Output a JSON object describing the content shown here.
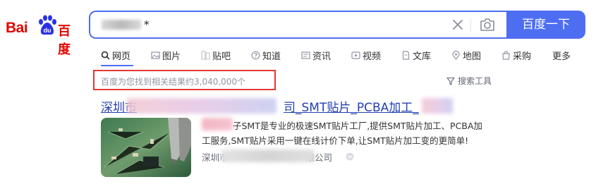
{
  "logo": {
    "text_latin": "Bai",
    "text_badge": "du",
    "text_cn": "百度"
  },
  "search": {
    "query": "*",
    "search_button": "百度一下"
  },
  "tabs": [
    {
      "label": "网页",
      "icon": "search-icon"
    },
    {
      "label": "图片",
      "icon": "image-icon"
    },
    {
      "label": "贴吧",
      "icon": "tieba-icon"
    },
    {
      "label": "知道",
      "icon": "question-icon"
    },
    {
      "label": "资讯",
      "icon": "news-icon"
    },
    {
      "label": "视频",
      "icon": "video-icon"
    },
    {
      "label": "文库",
      "icon": "document-icon"
    },
    {
      "label": "地图",
      "icon": "map-pin-icon"
    },
    {
      "label": "采购",
      "icon": "shopping-bag-icon"
    },
    {
      "label": "更多",
      "icon": ""
    }
  ],
  "results_info": {
    "count_text": "百度为您找到相关结果约3,040,000个",
    "tools_label": "搜索工具"
  },
  "result": {
    "title_prefix": "深圳市",
    "title_mid": "司_SMT贴片_PCBA加工_",
    "snippet_line1": "子SMT是专业的极速SMT贴片工厂,提供SMT贴片加工、PCBA加",
    "snippet_line2": "工服务,SMT贴片采用一键在线计价下单,让SMT贴片加工变的更简单!",
    "source_prefix": "深圳市",
    "source_suffix": "限公司"
  },
  "colors": {
    "accent": "#4e6ef2",
    "brand_red": "#e10601",
    "link": "#2440b3",
    "highlight_box": "#e53935"
  }
}
